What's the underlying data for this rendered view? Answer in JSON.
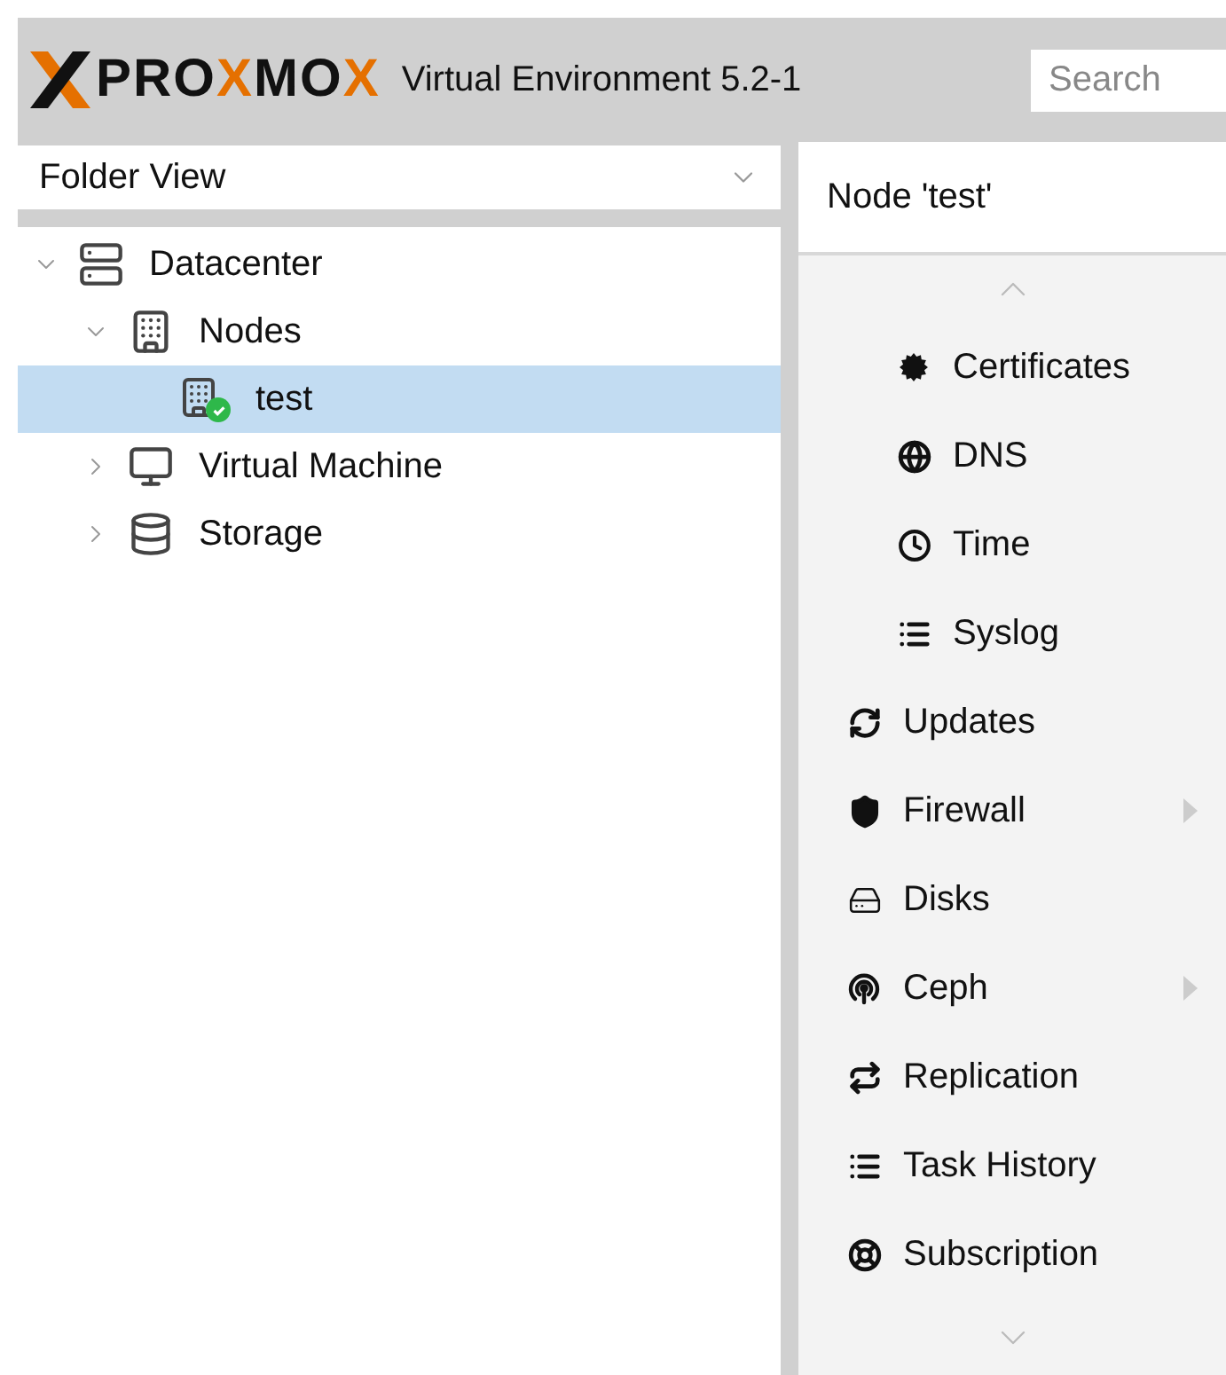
{
  "header": {
    "logo": [
      {
        "text": "PRO",
        "accent": false
      },
      {
        "text": "X",
        "accent": true
      },
      {
        "text": "MO",
        "accent": false
      },
      {
        "text": "X",
        "accent": true
      }
    ],
    "product": "Virtual Environment 5.2-1",
    "search": {
      "placeholder": "Search"
    }
  },
  "view_selector": {
    "value": "Folder View"
  },
  "tree": [
    {
      "label": "Datacenter",
      "kind": "datacenter",
      "expanded": true,
      "selected": false,
      "children": [
        {
          "label": "Nodes",
          "kind": "nodes",
          "expanded": true,
          "selected": false,
          "children": [
            {
              "label": "test",
              "kind": "node",
              "online": true,
              "selected": true
            }
          ]
        },
        {
          "label": "Virtual Machine",
          "kind": "vm",
          "expanded": false,
          "selected": false
        },
        {
          "label": "Storage",
          "kind": "storage",
          "expanded": false,
          "selected": false
        }
      ]
    }
  ],
  "panel": {
    "title": "Node 'test'",
    "menu": [
      {
        "label": "Certificates",
        "kind": "subitem",
        "has_submenu": false
      },
      {
        "label": "DNS",
        "kind": "subitem",
        "has_submenu": false
      },
      {
        "label": "Time",
        "kind": "subitem",
        "has_submenu": false
      },
      {
        "label": "Syslog",
        "kind": "subitem",
        "has_submenu": false
      },
      {
        "label": "Updates",
        "kind": "item",
        "has_submenu": false
      },
      {
        "label": "Firewall",
        "kind": "item",
        "has_submenu": true
      },
      {
        "label": "Disks",
        "kind": "item",
        "has_submenu": false
      },
      {
        "label": "Ceph",
        "kind": "item",
        "has_submenu": true
      },
      {
        "label": "Replication",
        "kind": "item",
        "has_submenu": false
      },
      {
        "label": "Task History",
        "kind": "item",
        "has_submenu": false
      },
      {
        "label": "Subscription",
        "kind": "item",
        "has_submenu": false
      }
    ]
  }
}
